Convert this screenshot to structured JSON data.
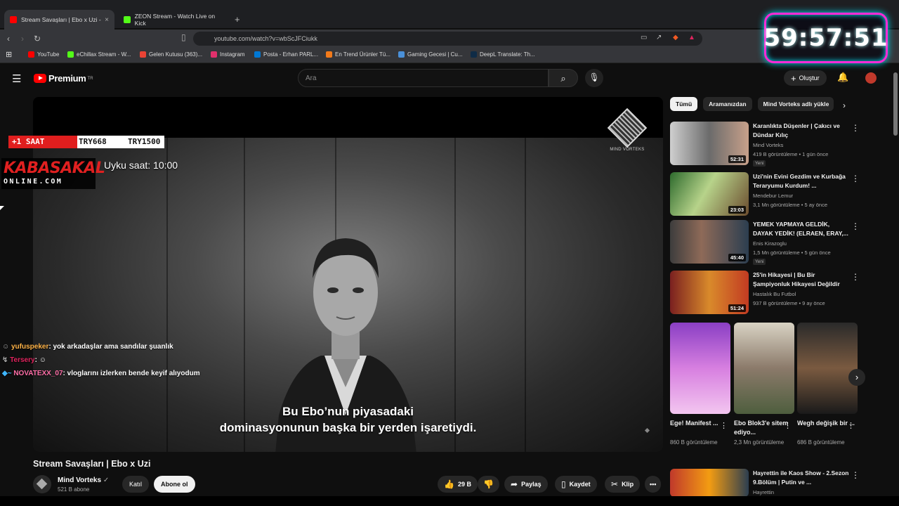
{
  "timer": "59:57:51",
  "browser": {
    "tabs": [
      {
        "title": "Stream Savaşları | Ebo x Uzi -",
        "color": "#ff0000"
      },
      {
        "title": "ZEON Stream - Watch Live on Kick",
        "color": "#53fc18"
      }
    ],
    "url": "youtube.com/watch?v=wbScJFCiukk",
    "bookmarks": [
      {
        "label": "YouTube",
        "color": "#ff0000"
      },
      {
        "label": "eChillax Stream - W...",
        "color": "#53fc18"
      },
      {
        "label": "Gelen Kutusu (363)...",
        "color": "#ea4335"
      },
      {
        "label": "Instagram",
        "color": "#e1306c"
      },
      {
        "label": "Posta - Erhan PARL...",
        "color": "#0078d4"
      },
      {
        "label": "En Trend Ürünler Tü...",
        "color": "#f27a1a"
      },
      {
        "label": "Gaming Gecesi | Cu...",
        "color": "#4a90d9"
      },
      {
        "label": "DeepL Translate: Th...",
        "color": "#0f2b46"
      }
    ]
  },
  "youtube": {
    "logo_text": "Premium",
    "logo_sup": "TR",
    "search_placeholder": "Ara",
    "create_label": "Oluştur"
  },
  "overlay": {
    "sub_bar": {
      "a": "+1 SAAT",
      "b": "TRY668",
      "c": "TRY1500"
    },
    "brand_top": "KABASAKAL",
    "brand_bottom": "ONLINE.COM",
    "sleep_time": "Uyku saat: 10:00",
    "chat": [
      {
        "user": "yufuspeker",
        "msg": ": yok arkadaşlar ama sandılar şuanlık",
        "color": "#ffb347"
      },
      {
        "user": "Tersery",
        "msg": ":",
        "color": "#e0245e"
      },
      {
        "user": "NOVATEXX_07",
        "msg": ": vloglarını izlerken bende keyif alıyodum",
        "color": "#ff6fa8"
      }
    ]
  },
  "video": {
    "subtitle_line1": "Bu Ebo’nun piyasadaki",
    "subtitle_line2": "dominasyonunun başka bir yerden işaretiydi.",
    "watermark": "MIND VORTEKS",
    "title": "Stream Savaşları | Ebo x Uzi",
    "channel": "Mind Vorteks",
    "subscribers": "521 B abone",
    "join_label": "Katıl",
    "subscribe_label": "Abone ol",
    "likes": "29 B",
    "share_label": "Paylaş",
    "save_label": "Kaydet",
    "clip_label": "Klip"
  },
  "sidebar": {
    "chips": [
      "Tümü",
      "Aramanızdan",
      "Mind Vorteks adlı yükle"
    ],
    "recommendations": [
      {
        "title": "Karanlıkta Düşenler | Çakıcı ve Dündar Kılıç",
        "channel": "Mind Vorteks",
        "views": "419 B görüntüleme • 1 gün önce",
        "badge": "Yeni",
        "duration": "52:31"
      },
      {
        "title": "Uzi'nin Evini Gezdim ve Kurbağa Teraryumu Kurdum! ...",
        "channel": "Mendebur Lemur",
        "views": "3,1 Mn görüntüleme • 5 ay önce",
        "badge": "",
        "duration": "23:03"
      },
      {
        "title": "YEMEK YAPMAYA GELDİK, DAYAK YEDİK! (ELRAEN, ERAY,...",
        "channel": "Enis Kirazoglu",
        "views": "1,5 Mn görüntüleme • 5 gün önce",
        "badge": "Yeni",
        "duration": "45:40"
      },
      {
        "title": "25'in Hikayesi | Bu Bir Şampiyonluk Hikayesi Değildir",
        "channel": "Hastalık Bu Futbol",
        "views": "937 B görüntüleme • 9 ay önce",
        "badge": "",
        "duration": "51:24"
      }
    ],
    "shorts": [
      {
        "title": "Ege! Manifest ...",
        "views": "860 B görüntüleme"
      },
      {
        "title": "Ebo Blok3'e sitem ediyo...",
        "views": "2,3 Mn görüntüleme"
      },
      {
        "title": "Wegh değişik bir ...",
        "views": "686 B görüntüleme"
      }
    ],
    "last_rec": {
      "title": "Hayrettin ile Kaos Show - 2.Sezon 9.Bölüm | Putin ve ...",
      "channel": "Hayrettin"
    }
  }
}
